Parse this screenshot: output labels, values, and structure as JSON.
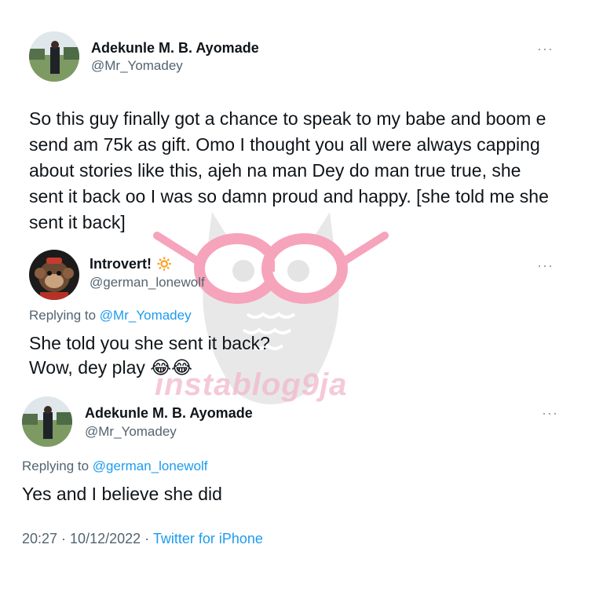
{
  "tweet_main": {
    "name": "Adekunle M. B. Ayomade",
    "handle": "@Mr_Yomadey",
    "more": "···",
    "text": "So this guy finally got a chance to speak to my babe and boom e send am 75k as gift. Omo I thought you all were always capping about stories like this, ajeh na man Dey do man true true, she sent it back oo I was so damn proud and happy. [she told me she sent it back]"
  },
  "reply_1": {
    "name": "Introvert!",
    "name_emoji": "🔅",
    "handle": "@german_lonewolf",
    "more": "···",
    "replying_prefix": "Replying to",
    "replying_to": "@Mr_Yomadey",
    "line1": "She told you she sent it back?",
    "line2": "Wow, dey play 😂😂"
  },
  "reply_2": {
    "name": "Adekunle M. B. Ayomade",
    "handle": "@Mr_Yomadey",
    "more": "···",
    "replying_prefix": "Replying to",
    "replying_to": "@german_lonewolf",
    "text": "Yes and I believe she did"
  },
  "meta": {
    "time": "20:27",
    "sep1": " · ",
    "date": "10/12/2022",
    "sep2": " · ",
    "source": "Twitter for iPhone"
  },
  "watermark": {
    "text": "instablog9ja",
    "icon": "owl-glasses-icon"
  },
  "colors": {
    "text": "#0f1419",
    "secondary": "#536471",
    "link": "#1d9bf0",
    "watermark_pink": "#f2b8cb"
  }
}
